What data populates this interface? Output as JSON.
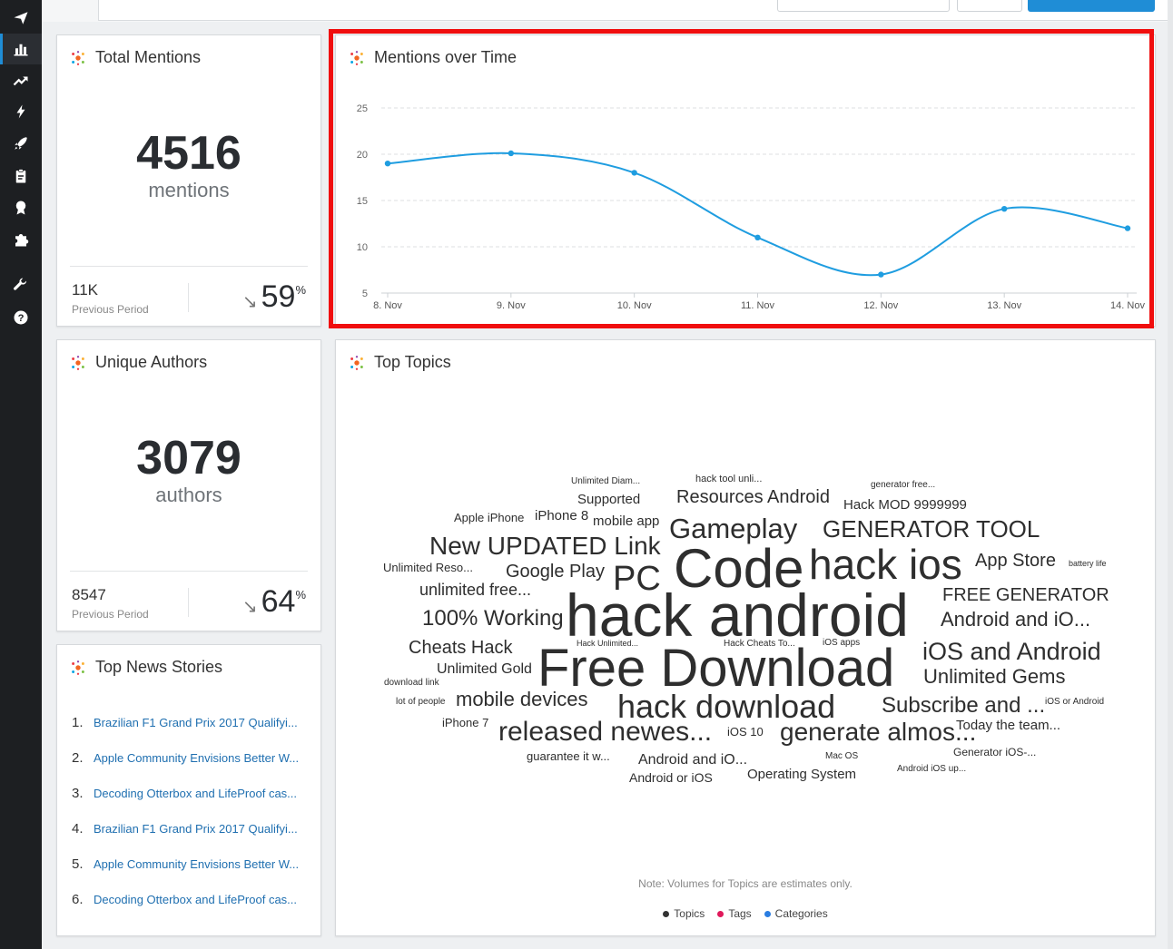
{
  "sidebar": {
    "items": [
      {
        "icon": "paper-plane-icon"
      },
      {
        "icon": "bar-chart-icon"
      },
      {
        "icon": "trending-up-icon"
      },
      {
        "icon": "lightning-icon"
      },
      {
        "icon": "rocket-icon"
      },
      {
        "icon": "clipboard-icon"
      },
      {
        "icon": "award-icon"
      },
      {
        "icon": "puzzle-icon"
      },
      {
        "icon": "wrench-icon"
      },
      {
        "icon": "help-icon"
      }
    ]
  },
  "total_mentions": {
    "title": "Total Mentions",
    "value": "4516",
    "unit": "mentions",
    "previous_value": "11K",
    "previous_label": "Previous Period",
    "change": "59",
    "change_symbol": "%",
    "change_direction": "down"
  },
  "unique_authors": {
    "title": "Unique Authors",
    "value": "3079",
    "unit": "authors",
    "previous_value": "8547",
    "previous_label": "Previous Period",
    "change": "64",
    "change_symbol": "%",
    "change_direction": "down"
  },
  "top_news": {
    "title": "Top News Stories",
    "items": [
      {
        "num": "1.",
        "text": "Brazilian F1 Grand Prix 2017 Qualifyi..."
      },
      {
        "num": "2.",
        "text": "Apple Community Envisions Better W..."
      },
      {
        "num": "3.",
        "text": "Decoding Otterbox and LifeProof cas..."
      },
      {
        "num": "4.",
        "text": "Brazilian F1 Grand Prix 2017 Qualifyi..."
      },
      {
        "num": "5.",
        "text": "Apple Community Envisions Better W..."
      },
      {
        "num": "6.",
        "text": "Decoding Otterbox and LifeProof cas..."
      }
    ]
  },
  "mentions_over_time": {
    "title": "Mentions over Time"
  },
  "chart_data": {
    "type": "line",
    "title": "Mentions over Time",
    "xlabel": "",
    "ylabel": "",
    "categories": [
      "8. Nov",
      "9. Nov",
      "10. Nov",
      "11. Nov",
      "12. Nov",
      "13. Nov",
      "14. Nov"
    ],
    "series": [
      {
        "values": [
          19,
          20.1,
          18,
          11,
          7,
          14.1,
          12
        ]
      }
    ],
    "y_ticks": [
      5,
      10,
      15,
      20,
      25
    ],
    "ylim": [
      5,
      25
    ],
    "grid": true,
    "line_color": "#1f9de0"
  },
  "top_topics": {
    "title": "Top Topics",
    "note": "Note: Volumes for Topics are estimates only.",
    "legend": [
      {
        "label": "Topics",
        "color": "#333333"
      },
      {
        "label": "Tags",
        "color": "#e0195b"
      },
      {
        "label": "Categories",
        "color": "#2a7de1"
      }
    ],
    "words": [
      {
        "text": "Unlimited Diam...",
        "size": 10
      },
      {
        "text": "hack tool unli...",
        "size": 11
      },
      {
        "text": "generator free...",
        "size": 10
      },
      {
        "text": "Supported",
        "size": 15
      },
      {
        "text": "Resources Android",
        "size": 20
      },
      {
        "text": "Hack MOD 9999999",
        "size": 15
      },
      {
        "text": "Apple iPhone",
        "size": 13
      },
      {
        "text": "iPhone 8",
        "size": 15
      },
      {
        "text": "mobile app",
        "size": 15
      },
      {
        "text": "Gameplay",
        "size": 31
      },
      {
        "text": "GENERATOR TOOL",
        "size": 26
      },
      {
        "text": "New UPDATED Link",
        "size": 28
      },
      {
        "text": "Unlimited Reso...",
        "size": 13
      },
      {
        "text": "Google Play",
        "size": 20
      },
      {
        "text": "PC",
        "size": 38
      },
      {
        "text": "Code",
        "size": 60
      },
      {
        "text": "hack ios",
        "size": 46
      },
      {
        "text": "App Store",
        "size": 20
      },
      {
        "text": "battery life",
        "size": 9
      },
      {
        "text": "unlimited free...",
        "size": 18
      },
      {
        "text": "FREE GENERATOR",
        "size": 20
      },
      {
        "text": "100% Working",
        "size": 24
      },
      {
        "text": "hack android",
        "size": 66
      },
      {
        "text": "Android and iO...",
        "size": 22
      },
      {
        "text": "Cheats Hack",
        "size": 20
      },
      {
        "text": "Hack Unlimited...",
        "size": 9
      },
      {
        "text": "Hack Cheats To...",
        "size": 10
      },
      {
        "text": "iOS apps",
        "size": 10
      },
      {
        "text": "iOS and Android",
        "size": 27
      },
      {
        "text": "Free Download",
        "size": 58
      },
      {
        "text": "Unlimited Gold",
        "size": 16
      },
      {
        "text": "Unlimited Gems",
        "size": 22
      },
      {
        "text": "download link",
        "size": 10
      },
      {
        "text": "lot of people",
        "size": 10
      },
      {
        "text": "mobile devices",
        "size": 22
      },
      {
        "text": "hack download",
        "size": 36
      },
      {
        "text": "Subscribe and ...",
        "size": 24
      },
      {
        "text": "iOS or Android",
        "size": 10
      },
      {
        "text": "iPhone 7",
        "size": 13
      },
      {
        "text": "released newes...",
        "size": 30
      },
      {
        "text": "iOS 10",
        "size": 13
      },
      {
        "text": "generate almos...",
        "size": 28
      },
      {
        "text": "Today the team...",
        "size": 15
      },
      {
        "text": "guarantee it w...",
        "size": 13
      },
      {
        "text": "Android and iO...",
        "size": 16
      },
      {
        "text": "Mac OS",
        "size": 10
      },
      {
        "text": "Generator iOS-...",
        "size": 12
      },
      {
        "text": "Android or iOS",
        "size": 14
      },
      {
        "text": "Operating System",
        "size": 15
      },
      {
        "text": "Android iOS up...",
        "size": 10
      }
    ]
  }
}
